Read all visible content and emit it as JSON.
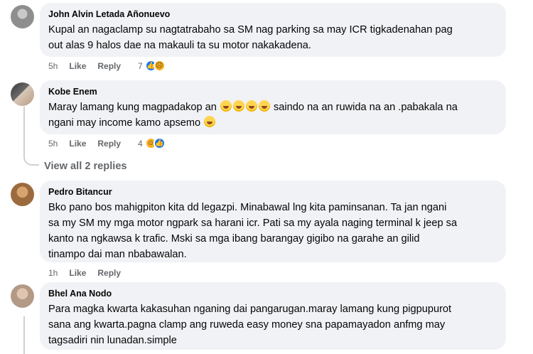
{
  "comments": [
    {
      "author": "John Alvin Letada Añonuevo",
      "text": "Kupal an nagaclamp su nagtatrabaho sa SM nag parking sa may ICR tigkadenahan pag\nout alas 9 halos dae na makauli ta su motor nakakadena.",
      "time": "5h",
      "like": "Like",
      "reply": "Reply",
      "reaction_count": "7"
    },
    {
      "author": "Kobe Enem",
      "text_a": "Maray lamang kung magpadakop an ",
      "text_b": " saindo na an ruwida na an .pabakala na",
      "text_c": "ngani may income kamo apsemo ",
      "time": "5h",
      "like": "Like",
      "reply": "Reply",
      "reaction_count": "4",
      "view_replies": "View all 2 replies"
    },
    {
      "author": "Pedro Bitancur",
      "text": "Bko pano bos mahigpiton kita dd legazpi. Minabawal lng kita paminsanan. Ta jan ngani\nsa my SM my mga motor ngpark sa harani icr. Pati sa my ayala naging terminal k jeep sa\nkanto na ngkawsa k trafic. Mski sa mga ibang barangay gigibo na garahe an gilid\ntinampo dai man nbabawalan.",
      "time": "1h",
      "like": "Like",
      "reply": "Reply"
    },
    {
      "author": "Bhel Ana Nodo",
      "text": "Para magka kwarta kakasuhan nganing dai pangarugan.maray lamang kung pigpupurot\nsana ang kwarta.pagna clamp ang ruweda easy money sna papamayadon anfmg may\ntagsadiri nin lunadan.simple"
    }
  ],
  "icons": {
    "like_reaction": "thumbs-up-icon",
    "sad_reaction": "sad-face-icon",
    "haha_reaction": "laughing-face-icon"
  },
  "colors": {
    "bubble": "#f0f2f5",
    "secondary_text": "#65676b",
    "like_blue": "#1877f2"
  }
}
